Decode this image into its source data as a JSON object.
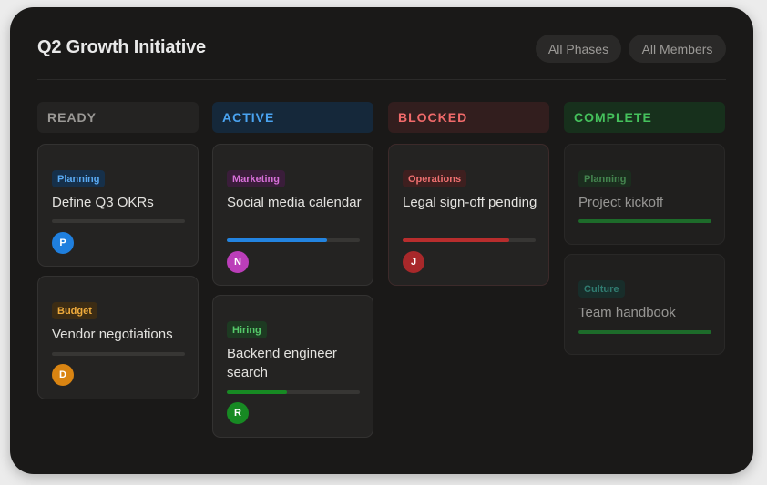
{
  "board": {
    "title": "Q2 Growth Initiative",
    "filters": {
      "phases": "All Phases",
      "members": "All Members"
    }
  },
  "columns": [
    {
      "label": "READY",
      "color": "#9a9895",
      "bg": "#242322"
    },
    {
      "label": "ACTIVE",
      "color": "#4aa3f0",
      "bg": "#15283a"
    },
    {
      "label": "BLOCKED",
      "color": "#f06a6a",
      "bg": "#321e1e"
    },
    {
      "label": "COMPLETE",
      "color": "#45c15c",
      "bg": "#17301c"
    }
  ],
  "cards": {
    "okrs": {
      "tag": "Planning",
      "title": "Define Q3 OKRs",
      "avatar": "P",
      "progress": 0,
      "tag_color": "#5aaaf2",
      "tag_bg": "#16304a",
      "avatar_bg": "#1f7fde",
      "progress_color": "#1f7fde"
    },
    "vendor": {
      "tag": "Budget",
      "title": "Vendor negotiations",
      "avatar": "D",
      "progress": 0,
      "tag_color": "#efab3c",
      "tag_bg": "#3c2c14",
      "avatar_bg": "#d98412",
      "progress_color": "#d98412"
    },
    "social": {
      "tag": "Marketing",
      "title": "Social media calendar",
      "avatar": "N",
      "progress": 0.75,
      "tag_color": "#d770d8",
      "tag_bg": "#3a1d3a",
      "avatar_bg": "#bb3eb9",
      "progress_color": "#2384e0"
    },
    "backend": {
      "tag": "Hiring",
      "title": "Backend engineer search",
      "avatar": "R",
      "progress": 0.45,
      "tag_color": "#55c869",
      "tag_bg": "#1d3a22",
      "avatar_bg": "#178a23",
      "progress_color": "#178a23"
    },
    "legal": {
      "tag": "Operations",
      "title": "Legal sign-off pending",
      "avatar": "J",
      "progress": 0.8,
      "tag_color": "#ef7070",
      "tag_bg": "#3e1f1f",
      "avatar_bg": "#a8282a",
      "progress_color": "#b82d2d"
    },
    "kickoff": {
      "tag": "Planning",
      "title": "Project kickoff",
      "progress": 1,
      "tag_color": "#5fc872",
      "tag_bg": "#1d3a22",
      "progress_color": "#1f9e35"
    },
    "handbook": {
      "tag": "Culture",
      "title": "Team handbook",
      "progress": 1,
      "tag_color": "#3fb8a7",
      "tag_bg": "#173a36",
      "progress_color": "#1f9e35"
    }
  }
}
